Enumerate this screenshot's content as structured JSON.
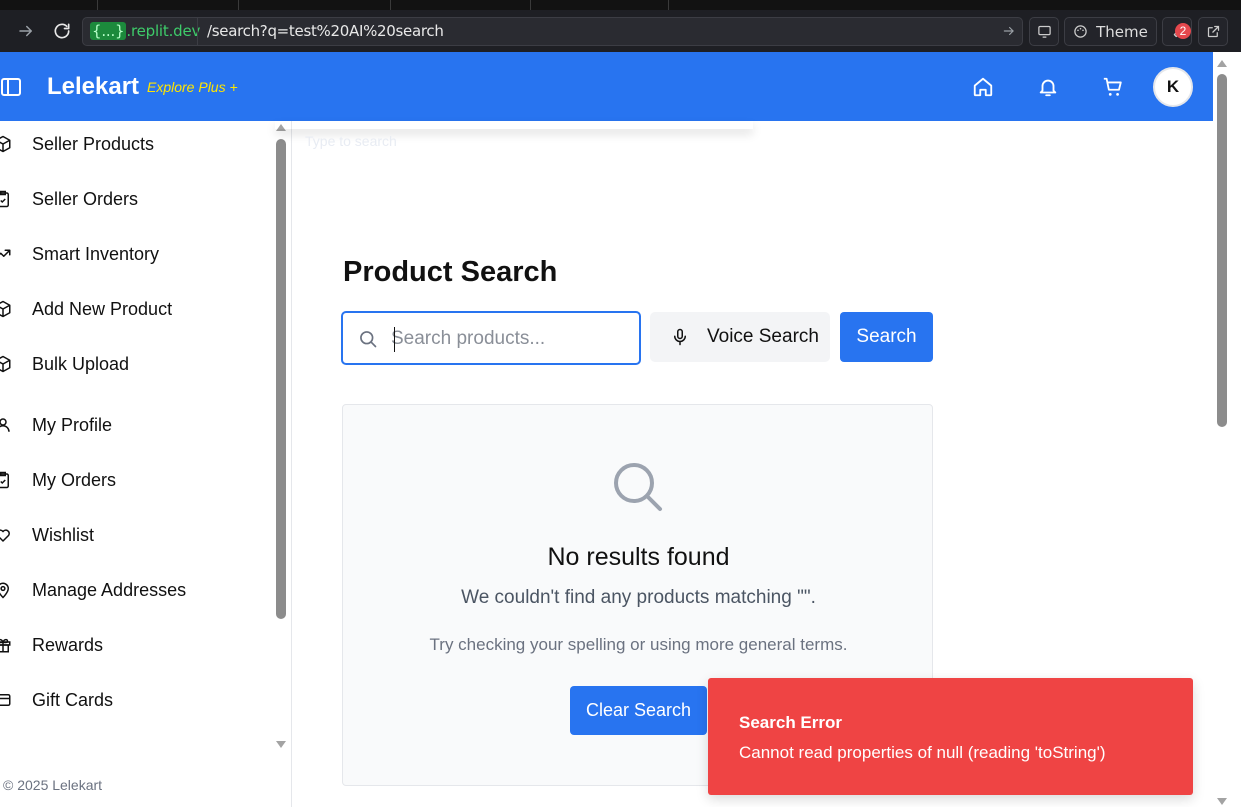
{
  "browser": {
    "url_host_prefix": "{...}",
    "url_host_suffix": ".replit.dev",
    "url_path": "/search?q=test%20AI%20search",
    "theme_label": "Theme",
    "notification_count": "2"
  },
  "header": {
    "logo": "Lelekart",
    "explore": "Explore Plus +",
    "avatar_initial": "K"
  },
  "sidebar": {
    "items": [
      {
        "label": "Seller Products",
        "icon": "package-icon"
      },
      {
        "label": "Seller Orders",
        "icon": "clipboard-icon"
      },
      {
        "label": "Smart Inventory",
        "icon": "trending-up-icon"
      },
      {
        "label": "Add New Product",
        "icon": "package-icon"
      },
      {
        "label": "Bulk Upload",
        "icon": "package-icon"
      },
      {
        "label": "My Profile",
        "icon": "user-icon"
      },
      {
        "label": "My Orders",
        "icon": "clipboard-icon"
      },
      {
        "label": "Wishlist",
        "icon": "heart-icon"
      },
      {
        "label": "Manage Addresses",
        "icon": "map-pin-icon"
      },
      {
        "label": "Rewards",
        "icon": "gift-icon"
      },
      {
        "label": "Gift Cards",
        "icon": "card-icon"
      }
    ],
    "copyright": "© 2025 Lelekart"
  },
  "main": {
    "overlay_text": "Type to search",
    "title": "Product Search",
    "search_placeholder": "Search products...",
    "search_value": "",
    "voice_label": "Voice Search",
    "search_label": "Search",
    "empty": {
      "title": "No results found",
      "message": "We couldn't find any products matching \"\".",
      "tip": "Try checking your spelling or using more general terms.",
      "clear_label": "Clear Search"
    }
  },
  "toast": {
    "title": "Search Error",
    "message": "Cannot read properties of null (reading 'toString')"
  },
  "colors": {
    "brand": "#2874f0",
    "accent": "#ffe500",
    "error": "#ef4444"
  }
}
